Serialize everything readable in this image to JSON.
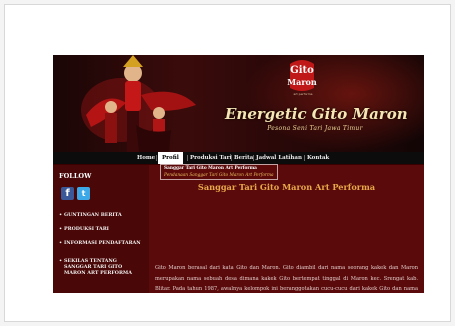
{
  "banner": {
    "logo_text": "Gito Maron",
    "logo_subtext": "art performa",
    "title": "Energetic Gito Maron",
    "tagline": "Pesona Seni Tari Jawa Timur"
  },
  "nav": {
    "items": [
      {
        "label": "Home"
      },
      {
        "label": "Profil"
      },
      {
        "label": "Produksi Tari"
      },
      {
        "label": "Berita"
      },
      {
        "label": "Jadwal Latihan"
      },
      {
        "label": "Kontak"
      }
    ]
  },
  "dropdown": {
    "items": [
      {
        "label": "Sanggar Tari Gito Maron Art Performa"
      },
      {
        "label": "Pendanaan Sanggar Tari Gito Maron Art Performa"
      }
    ]
  },
  "sidebar": {
    "follow_label": "FOLLOW",
    "social": [
      {
        "name": "facebook",
        "glyph": "f"
      },
      {
        "name": "twitter",
        "glyph": "t"
      }
    ],
    "items": [
      {
        "label": "GUNTINGAN BERITA"
      },
      {
        "label": "PRODUKSI TARI"
      },
      {
        "label": "INFORMASI PENDAFTARAN"
      },
      {
        "label": "SEKILAS TENTANG SANGGAR TARI GITO MARON ART PERFORMA"
      }
    ]
  },
  "content": {
    "title": "Sanggar Tari Gito Maron Art Performa",
    "body": "Gito Maron berasal dari kata Gito dan Maron. Gito diambil dari nama seorang kakek dan Maron merupakan nama sebuah desa dimana kakek Gito bertempat tinggal di Maron kec. Srengat kab. Blitar. Pada tahun 1987, awalnya kelompok ini beranggotakan cucu-cucu dari kakek Gito dan nama Gito Maron tidak terpikirkan secara konseptional sebagai identitas kelompok ini. Karena demi gampangnya orang sering menyebut secara spontan cucu-cucu mbah Gito Maron. Dari saat itulah nama Gito Maron mempunyai sebuah arti yang mudah diingat oleh beberapa kalangan"
  },
  "colors": {
    "site_bg": "#5a0a0a",
    "nav_bg": "#0c0c0c",
    "title_accent": "#e8a84a"
  }
}
